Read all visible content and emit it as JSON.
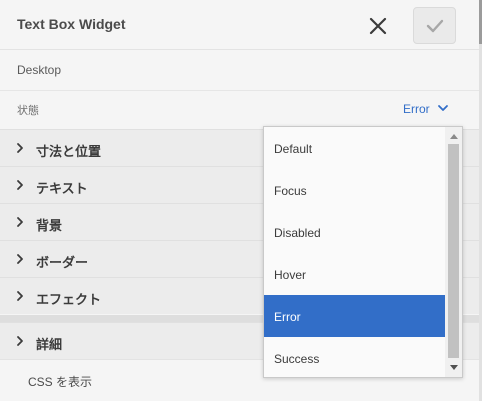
{
  "header": {
    "title": "Text Box Widget",
    "close_icon": "close-icon",
    "done_icon": "checkmark-icon"
  },
  "breadcrumb": {
    "label": "Desktop"
  },
  "state": {
    "label": "状態",
    "selected": "Error",
    "chevron_icon": "chevron-down-icon"
  },
  "sections": [
    {
      "label": "寸法と位置"
    },
    {
      "label": "テキスト"
    },
    {
      "label": "背景"
    },
    {
      "label": "ボーダー"
    },
    {
      "label": "エフェクト"
    },
    {
      "label": "詳細"
    }
  ],
  "css_link": {
    "label": "CSS を表示"
  },
  "dropdown": {
    "options": [
      "Default",
      "Focus",
      "Disabled",
      "Hover",
      "Error",
      "Success"
    ],
    "selected_index": 4
  },
  "colors": {
    "accent": "#326ec8",
    "text": "#3b3b3b",
    "panel_bg": "#f5f5f5",
    "section_bg": "#ececec"
  }
}
